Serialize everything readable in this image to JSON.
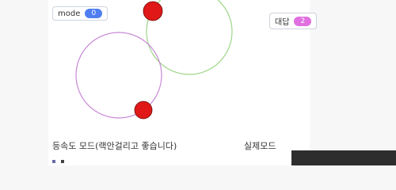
{
  "mode_badge": {
    "label": "mode",
    "value": "0",
    "color": "#4e7ef0"
  },
  "answer_badge": {
    "label": "대답",
    "value": "2",
    "color": "#e070e0"
  },
  "labels": {
    "constant_speed": "등속도 모드(랙안걸리고 좋습니다)",
    "real_mode": "실제모드"
  },
  "colors": {
    "circle_green": "#9ed68a",
    "circle_purple": "#c889d6",
    "dot_red": "#e01818"
  }
}
